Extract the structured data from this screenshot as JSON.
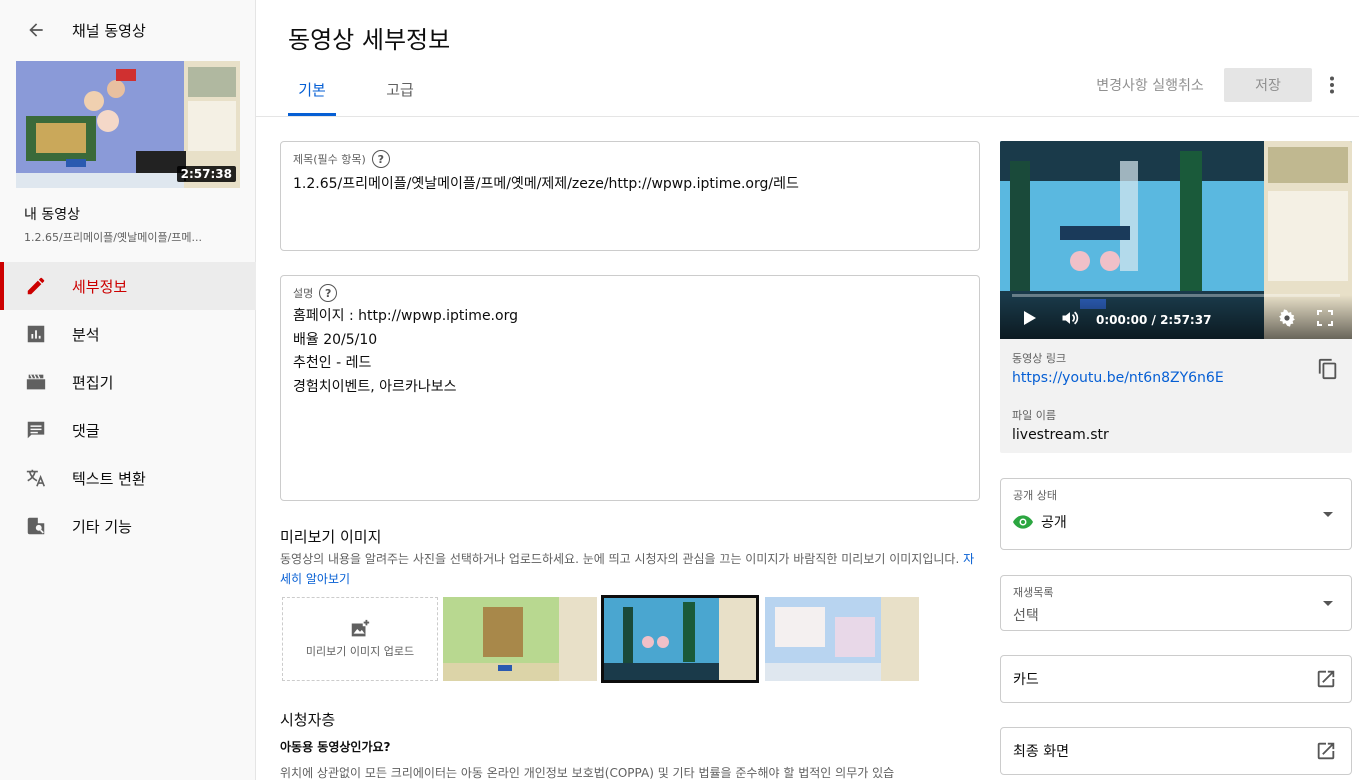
{
  "sidebar": {
    "back_label": "채널 동영상",
    "thumbnail_duration": "2:57:38",
    "my_video_title": "내 동영상",
    "my_video_subtitle": "1.2.65/프리메이플/옛날메이플/프메...",
    "nav": [
      {
        "label": "세부정보",
        "icon": "pencil-icon",
        "active": true
      },
      {
        "label": "분석",
        "icon": "analytics-icon",
        "active": false
      },
      {
        "label": "편집기",
        "icon": "editor-clapper-icon",
        "active": false
      },
      {
        "label": "댓글",
        "icon": "comment-icon",
        "active": false
      },
      {
        "label": "텍스트 변환",
        "icon": "translate-icon",
        "active": false
      },
      {
        "label": "기타 기능",
        "icon": "other-features-icon",
        "active": false
      }
    ]
  },
  "header": {
    "title": "동영상 세부정보",
    "tabs": [
      {
        "label": "기본",
        "active": true
      },
      {
        "label": "고급",
        "active": false
      }
    ],
    "undo_label": "변경사항 실행취소",
    "save_label": "저장"
  },
  "form": {
    "title_label": "제목(필수 항목)",
    "title_value": "1.2.65/프리메이플/옛날메이플/프메/옛메/제제/zeze/http://wpwp.iptime.org/레드",
    "description_label": "설명",
    "description_lines": [
      "홈페이지 : http://wpwp.iptime.org",
      "배율 20/5/10",
      "추천인 - 레드",
      "경험치이벤트, 아르카나보스"
    ],
    "thumbnail_section_title": "미리보기 이미지",
    "thumbnail_section_desc": "동영상의 내용을 알려주는 사진을 선택하거나 업로드하세요. 눈에 띄고 시청자의 관심을 끄는 이미지가 바람직한 미리보기 이미지입니다.",
    "thumbnail_learn_more": "자세히 알아보기",
    "thumbnail_upload_label": "미리보기 이미지 업로드",
    "audience_title": "시청자층",
    "audience_question": "아동용 동영상인가요?",
    "audience_desc": "위치에 상관없이 모든 크리에이터는 아동 온라인 개인정보 보호법(COPPA) 및 기타 법률을 준수해야 할 법적인 의무가 있습"
  },
  "preview": {
    "time_display": "0:00:00 / 2:57:37",
    "video_link_label": "동영상 링크",
    "video_link": "https://youtu.be/nt6n8ZY6n6E",
    "file_name_label": "파일 이름",
    "file_name": "livestream.str"
  },
  "visibility": {
    "label": "공개 상태",
    "value": "공개"
  },
  "playlist": {
    "label": "재생목록",
    "value": "선택"
  },
  "cards": {
    "label": "카드"
  },
  "end_screen": {
    "label": "최종 화면"
  },
  "colors": {
    "accent": "#065fd4",
    "active_nav": "#cc0000",
    "visibility_icon": "#2ba640"
  }
}
